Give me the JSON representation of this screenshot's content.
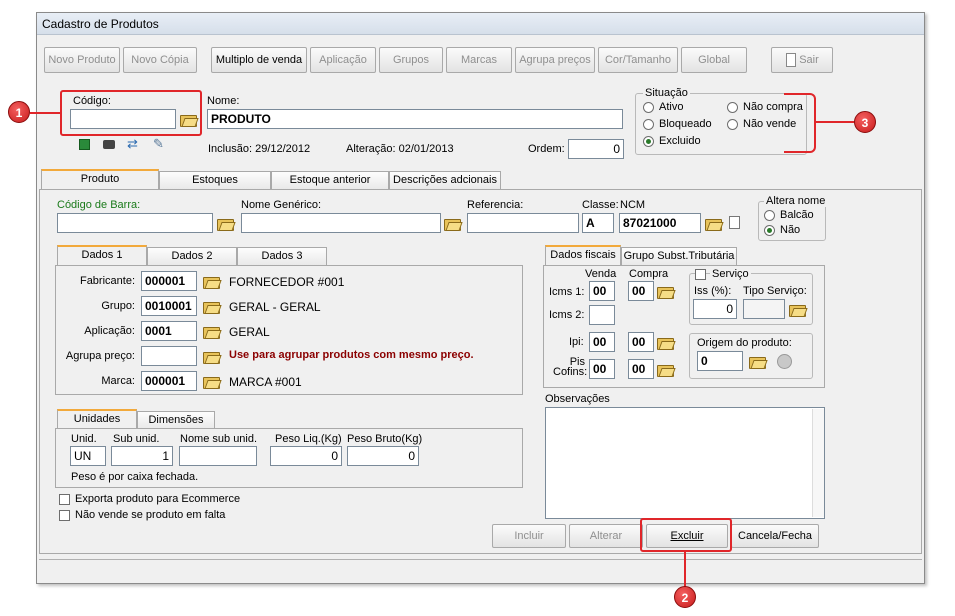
{
  "window": {
    "title": "Cadastro de Produtos"
  },
  "toolbar": [
    {
      "label": "Novo Produto",
      "enabled": false
    },
    {
      "label": "Novo Cópia",
      "enabled": false
    },
    {
      "label": "Multiplo de venda",
      "enabled": true
    },
    {
      "label": "Aplicação",
      "enabled": false
    },
    {
      "label": "Grupos",
      "enabled": false
    },
    {
      "label": "Marcas",
      "enabled": false
    },
    {
      "label": "Agrupa preços",
      "enabled": false
    },
    {
      "label": "Cor/Tamanho",
      "enabled": false
    },
    {
      "label": "Global",
      "enabled": false
    },
    {
      "label": "Sair",
      "enabled": false
    }
  ],
  "header": {
    "codigo_label": "Código:",
    "codigo_value": "",
    "nome_label": "Nome:",
    "nome_value": "PRODUTO",
    "inclusao": "Inclusão: 29/12/2012",
    "alteracao": "Alteração:   02/01/2013",
    "ordem_label": "Ordem:",
    "ordem_value": "0"
  },
  "situacao": {
    "label": "Situação",
    "options": [
      "Ativo",
      "Não compra",
      "Bloqueado",
      "Não vende",
      "Excluido"
    ],
    "selected": "Excluido"
  },
  "main_tabs": [
    "Produto",
    "Estoques",
    "Estoque anterior",
    "Descrições adcionais"
  ],
  "produto": {
    "codigo_barra_label": "Código de Barra:",
    "nome_generico_label": "Nome Genérico:",
    "referencia_label": "Referencia:",
    "classe_label": "Classe:",
    "classe_value": "A",
    "ncm_label": "NCM",
    "ncm_value": "87021000",
    "altera_nome": {
      "label": "Altera nome",
      "options": [
        "Balcão",
        "Não"
      ],
      "selected": "Não"
    }
  },
  "dados_tabs": [
    "Dados 1",
    "Dados 2",
    "Dados 3"
  ],
  "dados1": {
    "rows": [
      {
        "label": "Fabricante:",
        "code": "000001",
        "desc": "FORNECEDOR #001"
      },
      {
        "label": "Grupo:",
        "code": "0010001",
        "desc": "GERAL - GERAL"
      },
      {
        "label": "Aplicação:",
        "code": "0001",
        "desc": "GERAL"
      },
      {
        "label": "Agrupa preço:",
        "code": "",
        "desc": "Use para agrupar produtos com mesmo preço."
      },
      {
        "label": "Marca:",
        "code": "000001",
        "desc": "MARCA #001"
      }
    ]
  },
  "unidades_tabs": [
    "Unidades",
    "Dimensões"
  ],
  "unidades": {
    "col_unid": "Unid.",
    "col_sub": "Sub unid.",
    "col_nome_sub": "Nome sub unid.",
    "col_liq": "Peso Liq.(Kg)",
    "col_bruto": "Peso Bruto(Kg)",
    "unid_value": "UN",
    "sub_value": "1",
    "nome_sub_value": "",
    "liq_value": "0",
    "bruto_value": "0",
    "note": "Peso é por caixa fechada."
  },
  "checks": {
    "ecommerce": "Exporta produto para Ecommerce",
    "falta": "Não vende se produto em falta"
  },
  "fiscal_tabs": [
    "Dados fiscais",
    "Grupo Subst.Tributária"
  ],
  "fiscal": {
    "venda_label": "Venda",
    "compra_label": "Compra",
    "icms1_label": "Icms 1:",
    "icms1_venda": "00",
    "icms1_compra": "00",
    "icms2_label": "Icms 2:",
    "ipi_label": "Ipi:",
    "ipi_venda": "00",
    "ipi_compra": "00",
    "pis_label": "Pis Cofins:",
    "pis_venda": "00",
    "pis_compra": "00",
    "servico_label": "Serviço",
    "iss_label": "Iss (%):",
    "iss_value": "0",
    "tipo_servico_label": "Tipo Serviço:",
    "origem_label": "Origem do produto:",
    "origem_value": "0"
  },
  "observacoes_label": "Observações",
  "actions": [
    "Incluir",
    "Alterar",
    "Excluir",
    "Cancela/Fecha"
  ],
  "callouts": [
    "1",
    "2",
    "3"
  ],
  "colors": {
    "callout": "#e0262a",
    "tab_accent": "#f2a93b",
    "green_label": "#1a7a1a",
    "desc_red": "#8b0000"
  }
}
